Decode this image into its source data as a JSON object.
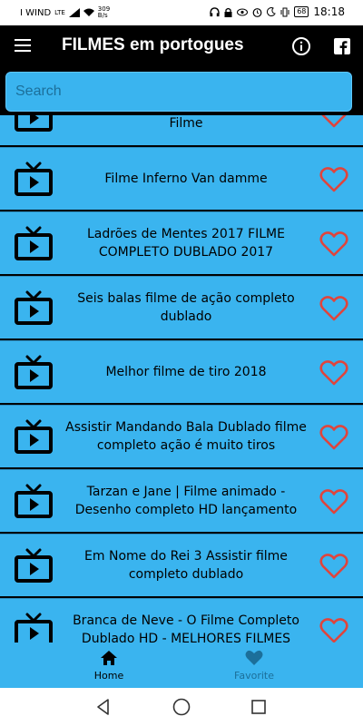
{
  "status_bar": {
    "carrier": "I WIND",
    "network": "LTE",
    "speed_value": "309",
    "speed_unit": "B/s",
    "battery": "68",
    "time": "18:18"
  },
  "app_bar": {
    "title": "FILMES em portogues",
    "menu_icon": "hamburger-menu-icon",
    "info_icon": "info-circle-icon",
    "facebook_icon": "facebook-icon"
  },
  "search": {
    "placeholder": "Search",
    "value": ""
  },
  "items": [
    {
      "title": "VAN DAMME - Operação Fronteira Filme"
    },
    {
      "title": "Filme   Inferno Van damme"
    },
    {
      "title": "Ladrões de Mentes 2017 FILME COMPLETO DUBLADO 2017"
    },
    {
      "title": "Seis balas  filme de ação completo dublado"
    },
    {
      "title": "Melhor filme de tiro 2018"
    },
    {
      "title": "Assistir Mandando Bala Dublado filme completo ação é muito tiros"
    },
    {
      "title": "Tarzan e Jane | Filme animado - Desenho completo HD lançamento"
    },
    {
      "title": "Em Nome do Rei 3   Assistir filme completo dublado"
    },
    {
      "title": "Branca de Neve -  O Filme Completo Dublado HD - MELHORES FILMES"
    }
  ],
  "bottom_nav": {
    "home_label": "Home",
    "favorite_label": "Favorite",
    "active": "Home"
  },
  "colors": {
    "accent": "#3ab4ef",
    "app_bar": "#000000",
    "heart": "#e0443c",
    "nav_inactive": "#1c6f9a"
  }
}
